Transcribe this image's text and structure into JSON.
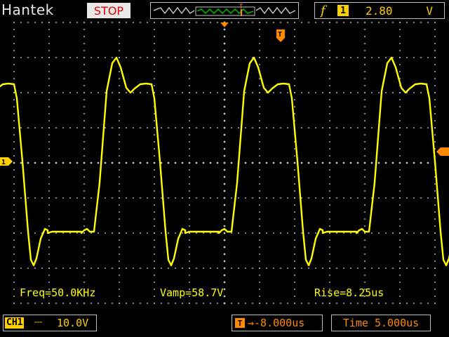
{
  "header": {
    "brand": "Hantek",
    "run_state": "STOP",
    "trigger": {
      "edge_icon": "rising-edge-icon",
      "source": "1",
      "level": "2.80",
      "unit": "V"
    }
  },
  "screen": {
    "channel_marker": "1",
    "measurements": {
      "freq": "Freq=50.0KHz",
      "vamp": "Vamp=58.7V",
      "rise": "Rise=8.25us"
    }
  },
  "footer": {
    "channel": {
      "label": "CH1",
      "coupling": "⎓",
      "scale": "10.0V"
    },
    "trigger_position": {
      "icon": "T",
      "value": "→-8.000us"
    },
    "timebase": "Time 5.000us"
  },
  "colors": {
    "trace": "#ffff00",
    "channel": "#ffd000",
    "trigger": "#ff8a00",
    "stop_text": "#e00000",
    "grid": "#cccccc"
  }
}
